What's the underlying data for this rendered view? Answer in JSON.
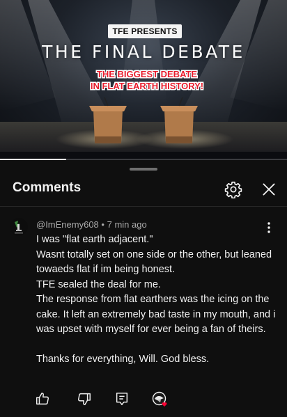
{
  "video": {
    "badge": "TFE PRESENTS",
    "title": "THE FINAL DEBATE",
    "subtitle_line1": "THE BIGGEST DEBATE",
    "subtitle_line2": "IN FLAT EARTH HISTORY!",
    "progress": 0.23
  },
  "comments": {
    "title": "Comments",
    "settings_icon": "gear-icon",
    "close_icon": "close-icon"
  },
  "comment": {
    "author": "@ImEnemy608",
    "separator": "•",
    "time": "7 min ago",
    "lines": [
      "I was \"flat earth adjacent.\"",
      "Wasnt totally set on one side or the other, but leaned towaeds flat if im being honest.",
      "TFE sealed the deal for me.",
      "The response from flat earthers was the icing on the cake. It left an extremely bad taste in my mouth, and i was upset with myself for ever being a fan of theirs.",
      "",
      "Thanks for everything, Will. God bless."
    ],
    "actions": [
      "like-icon",
      "dislike-icon",
      "reply-icon",
      "creator-heart-icon"
    ]
  },
  "colors": {
    "background": "#0f0f0f",
    "text_primary": "#f1f1f1",
    "text_secondary": "#aaaaaa",
    "subtitle_red": "#e81d2d",
    "heart_red": "#ff0033"
  }
}
